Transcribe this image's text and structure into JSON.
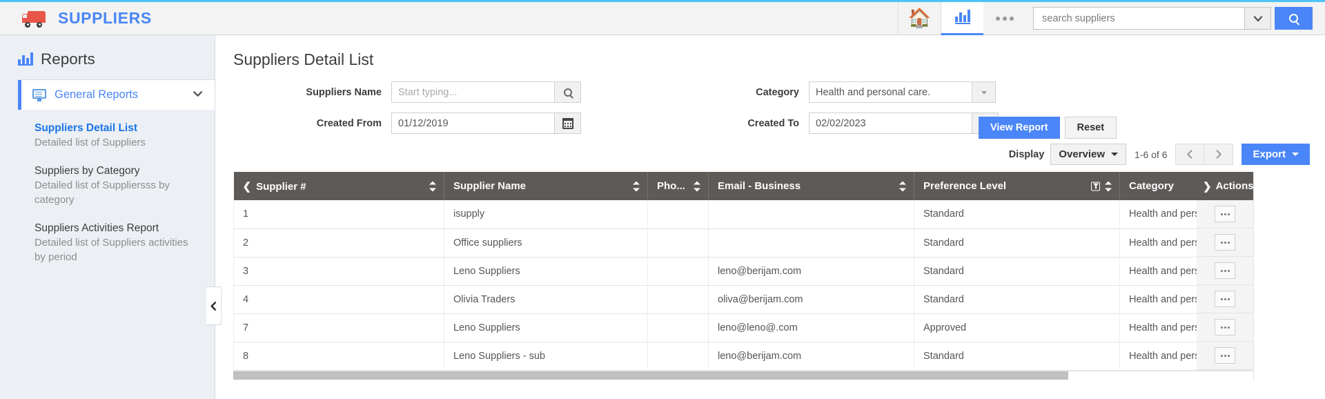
{
  "topbar": {
    "brand_title": "SUPPLIERS",
    "brand_icon": "truck-icon",
    "home_icon": "home-icon",
    "reports_icon": "bar-chart-icon",
    "more_icon": "ellipsis-icon",
    "search_placeholder": "search suppliers",
    "search_value": "",
    "search_caret_icon": "chevron-down-icon",
    "search_go_icon": "search-icon",
    "accent_color": "#4a86f7",
    "top_border_color": "#4fc3f7"
  },
  "sidebar": {
    "title": "Reports",
    "title_icon": "bar-chart-icon",
    "group": {
      "label": "General Reports",
      "icon": "monitor-icon",
      "chevron_icon": "chevron-down-icon"
    },
    "items": [
      {
        "name": "Suppliers Detail List",
        "desc": "Detailed list of Suppliers",
        "active": true
      },
      {
        "name": "Suppliers by Category",
        "desc": "Detailed list of Suppliersss by category",
        "active": false
      },
      {
        "name": "Suppliers Activities Report",
        "desc": "Detailed list of Suppliers activities by period",
        "active": false
      }
    ],
    "collapse_icon": "chevron-left-icon"
  },
  "main": {
    "page_title": "Suppliers Detail List",
    "filters": {
      "suppliers_name_label": "Suppliers Name",
      "suppliers_name_placeholder": "Start typing...",
      "suppliers_name_value": "",
      "suppliers_name_search_icon": "search-icon",
      "created_from_label": "Created From",
      "created_from_value": "01/12/2019",
      "created_from_icon": "calendar-icon",
      "category_label": "Category",
      "category_value": "Health and personal care.",
      "category_caret_icon": "chevron-down-icon",
      "created_to_label": "Created To",
      "created_to_value": "02/02/2023",
      "created_to_icon": "calendar-icon",
      "view_report_label": "View Report",
      "reset_label": "Reset"
    },
    "toolbar": {
      "display_label": "Display",
      "display_value": "Overview",
      "range_label": "1-6 of 6",
      "prev_icon": "chevron-left-icon",
      "next_icon": "chevron-right-icon",
      "export_label": "Export"
    },
    "table": {
      "columns": [
        {
          "label": "Supplier #",
          "sortable": true,
          "leading_icon": "chevron-left-icon",
          "filter": false
        },
        {
          "label": "Supplier Name",
          "sortable": true,
          "leading_icon": "",
          "filter": false
        },
        {
          "label": "Pho...",
          "sortable": true,
          "leading_icon": "",
          "filter": false
        },
        {
          "label": "Email - Business",
          "sortable": true,
          "leading_icon": "",
          "filter": false
        },
        {
          "label": "Preference Level",
          "sortable": true,
          "leading_icon": "",
          "filter": true
        },
        {
          "label": "Category",
          "sortable": false,
          "leading_icon": "",
          "filter": false
        }
      ],
      "actions_column": {
        "label": "Actions",
        "leading_icon": "chevron-right-icon",
        "row_button_icon": "ellipsis-icon"
      },
      "rows": [
        {
          "supplier_no": "1",
          "supplier_name": "isupply",
          "phone": "",
          "email": "",
          "preference": "Standard",
          "category": "Health and personal car"
        },
        {
          "supplier_no": "2",
          "supplier_name": "Office suppliers",
          "phone": "",
          "email": "",
          "preference": "Standard",
          "category": "Health and personal car"
        },
        {
          "supplier_no": "3",
          "supplier_name": "Leno Suppliers",
          "phone": "",
          "email": "leno@berijam.com",
          "preference": "Standard",
          "category": "Health and personal car"
        },
        {
          "supplier_no": "4",
          "supplier_name": "Olivia Traders",
          "phone": "",
          "email": "oliva@berijam.com",
          "preference": "Standard",
          "category": "Health and personal car"
        },
        {
          "supplier_no": "7",
          "supplier_name": "Leno Suppliers",
          "phone": "",
          "email": "leno@leno@.com",
          "preference": "Approved",
          "category": "Health and personal car"
        },
        {
          "supplier_no": "8",
          "supplier_name": "Leno Suppliers - sub",
          "phone": "",
          "email": "leno@berijam.com",
          "preference": "Standard",
          "category": "Health and personal car"
        }
      ]
    }
  }
}
